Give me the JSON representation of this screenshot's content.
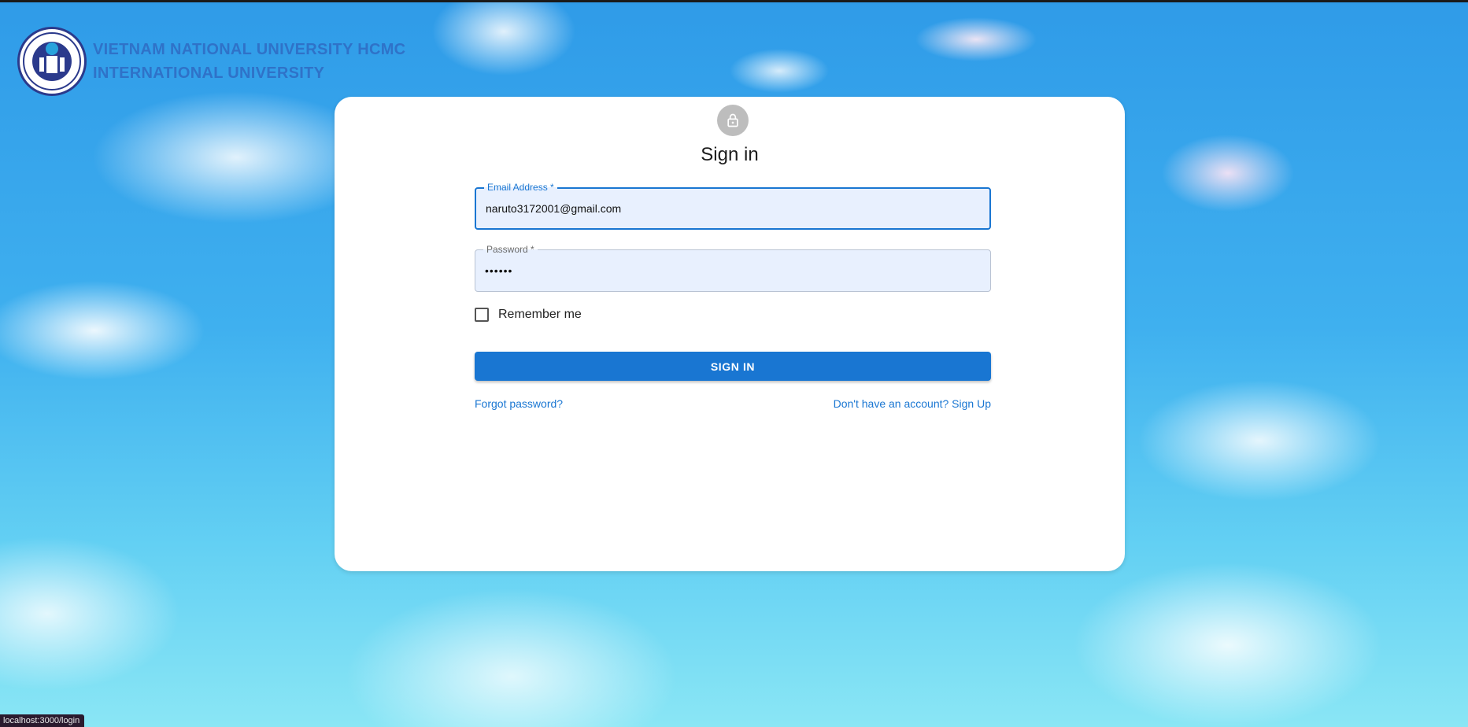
{
  "header": {
    "university_line1": "VIETNAM NATIONAL UNIVERSITY HCMC",
    "university_line2": "INTERNATIONAL UNIVERSITY",
    "logo_icon": "university-seal-icon"
  },
  "form": {
    "avatar_icon": "lock-icon",
    "title": "Sign in",
    "email_label": "Email Address *",
    "email_value": "naruto3172001@gmail.com",
    "password_label": "Password *",
    "password_value": "••••••",
    "remember_label": "Remember me",
    "remember_checked": false,
    "submit_label": "SIGN IN",
    "forgot_link": "Forgot password?",
    "signup_link": "Don't have an account? Sign Up"
  },
  "status_bar": {
    "url": "localhost:3000/login"
  },
  "colors": {
    "accent": "#1976d2",
    "brand_text": "#2f72c8",
    "field_bg": "#e8f0fe"
  }
}
